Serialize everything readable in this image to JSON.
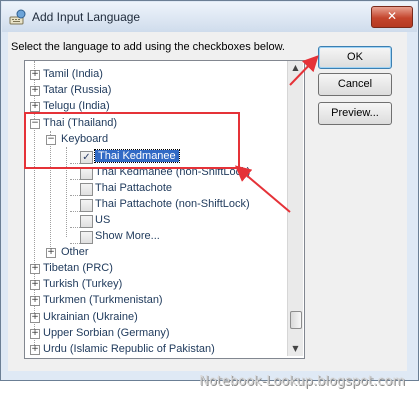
{
  "window": {
    "title": "Add Input Language",
    "close_glyph": "✕",
    "app_icon": "keyboard-globe-icon"
  },
  "instruction": "Select the language to add using the checkboxes below.",
  "tree": {
    "items": [
      {
        "label": "Tamil (India)",
        "expander": "+"
      },
      {
        "label": "Tatar (Russia)",
        "expander": "+"
      },
      {
        "label": "Telugu (India)",
        "expander": "+"
      },
      {
        "label": "Thai (Thailand)",
        "expander": "−"
      },
      {
        "label": "Keyboard",
        "expander": "−"
      },
      {
        "label": "Thai Kedmanee",
        "checked": true,
        "selected": true
      },
      {
        "label": "Thai Kedmanee (non-ShiftLock)",
        "checked": false
      },
      {
        "label": "Thai Pattachote",
        "checked": false
      },
      {
        "label": "Thai Pattachote (non-ShiftLock)",
        "checked": false
      },
      {
        "label": "US",
        "checked": false
      },
      {
        "label": "Show More...",
        "checked": false
      },
      {
        "label": "Other",
        "expander": "+"
      },
      {
        "label": "Tibetan (PRC)",
        "expander": "+"
      },
      {
        "label": "Turkish (Turkey)",
        "expander": "+"
      },
      {
        "label": "Turkmen (Turkmenistan)",
        "expander": "+"
      },
      {
        "label": "Ukrainian (Ukraine)",
        "expander": "+"
      },
      {
        "label": "Upper Sorbian (Germany)",
        "expander": "+"
      },
      {
        "label": "Urdu (Islamic Republic of Pakistan)",
        "expander": "+"
      }
    ],
    "check_glyph": "✓",
    "scroll_up_glyph": "▲",
    "scroll_down_glyph": "▼"
  },
  "buttons": {
    "ok": "OK",
    "cancel": "Cancel",
    "preview": "Preview..."
  },
  "annotation": {
    "color": "#e53238"
  },
  "watermark": "Notebook-Lookup.blogspot.com"
}
